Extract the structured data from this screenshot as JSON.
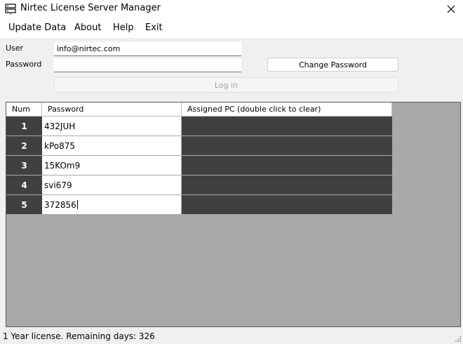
{
  "window": {
    "title": "Nirtec License Server Manager"
  },
  "menu": [
    "Update Data",
    "About",
    "Help",
    "Exit"
  ],
  "login": {
    "user_label": "User",
    "user_value": "info@nirtec.com",
    "password_label": "Password",
    "password_value": "",
    "change_password_label": "Change Password",
    "login_label": "Log in"
  },
  "table": {
    "headers": [
      "Num",
      "Password",
      "Assigned PC (double click to clear)"
    ],
    "rows": [
      {
        "num": "1",
        "password": "432JUH",
        "pc": ""
      },
      {
        "num": "2",
        "password": "kPo875",
        "pc": ""
      },
      {
        "num": "3",
        "password": "15KOm9",
        "pc": ""
      },
      {
        "num": "4",
        "password": "svi679",
        "pc": ""
      },
      {
        "num": "5",
        "password": "372856",
        "pc": ""
      }
    ]
  },
  "status": {
    "text": "1 Year license. Remaining days: 326"
  },
  "colors": {
    "row_header_bg": "#404040",
    "grid_bg": "#a9a9a9"
  }
}
